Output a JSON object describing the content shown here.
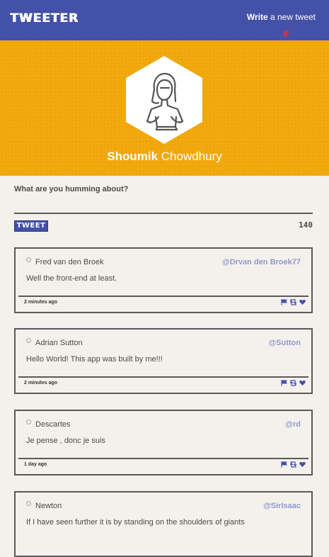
{
  "app": {
    "logo": "TWEETER"
  },
  "nav": {
    "compose_bold": "Write",
    "compose_rest": " a new tweet",
    "chevron_icon": "double-chevron-down-icon"
  },
  "colors": {
    "primary": "#4451a8",
    "hero": "#f2a90c",
    "handle": "#8f99cf",
    "background": "#f4f1ec"
  },
  "profile": {
    "first_name": "Shoumik",
    "last_name": "Chowdhury",
    "avatar_icon": "user-avatar-icon"
  },
  "composer": {
    "prompt": "What are you humming about?",
    "button_label": "TWEET",
    "char_count": "140"
  },
  "tweets": [
    {
      "name": "Fred van den Broek",
      "handle": "@Drvan den Broek77",
      "text": "Well the front-end at least.",
      "time": "2 minutes ago"
    },
    {
      "name": "Adrian Sutton",
      "handle": "@Sutton",
      "text": "Hello World! This app was built by me!!!",
      "time": "2 minutes ago"
    },
    {
      "name": "Descartes",
      "handle": "@rd",
      "text": "Je pense , donc je suis",
      "time": "1 day ago"
    },
    {
      "name": "Newton",
      "handle": "@SirIsaac",
      "text": "If I have seen further it is by standing on the shoulders of giants",
      "time": ""
    }
  ]
}
